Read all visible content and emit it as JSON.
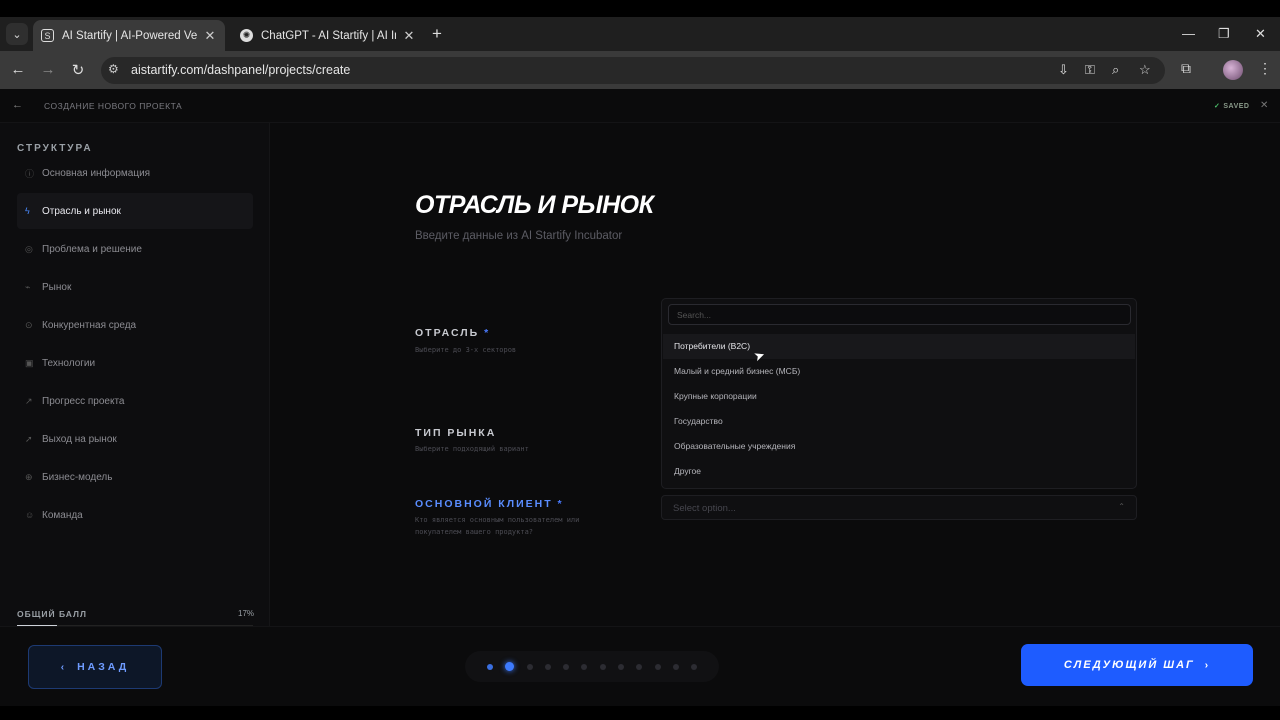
{
  "browser": {
    "tabs": [
      {
        "title": "AI Startify | AI-Powered Venture",
        "active": true
      },
      {
        "title": "ChatGPT - AI Startify | AI Incuba",
        "active": false
      }
    ],
    "url": "aistartify.com/dashpanel/projects/create"
  },
  "header": {
    "title": "СОЗДАНИЕ НОВОГО ПРОЕКТА",
    "saved": "SAVED"
  },
  "sidebar": {
    "title": "СТРУКТУРА",
    "items": [
      {
        "label": "Основная информация",
        "icon": "info-icon"
      },
      {
        "label": "Отрасль и рынок",
        "icon": "pulse-icon",
        "active": true
      },
      {
        "label": "Проблема и решение",
        "icon": "target-icon"
      },
      {
        "label": "Рынок",
        "icon": "chart-icon"
      },
      {
        "label": "Конкурентная среда",
        "icon": "compete-icon"
      },
      {
        "label": "Технологии",
        "icon": "chip-icon"
      },
      {
        "label": "Прогресс проекта",
        "icon": "progress-icon"
      },
      {
        "label": "Выход на рынок",
        "icon": "rocket-icon"
      },
      {
        "label": "Бизнес-модель",
        "icon": "globe-icon"
      },
      {
        "label": "Команда",
        "icon": "team-icon"
      }
    ],
    "score_label": "ОБЩИЙ БАЛЛ",
    "score_value": "17%",
    "score_fraction": 0.17
  },
  "main": {
    "title": "ОТРАСЛЬ И РЫНОК",
    "subtitle": "Введите данные из AI Startify Incubator",
    "fields": [
      {
        "label": "ОТРАСЛЬ",
        "required": "*",
        "hint": "Выберите до 3-х секторов"
      },
      {
        "label": "ТИП РЫНКА",
        "required": "",
        "hint": "Выберите подходящий вариант"
      },
      {
        "label": "ОСНОВНОЙ КЛИЕНТ",
        "required": "*",
        "hint": "Кто является основным пользователем или покупателем вашего продукта?"
      }
    ],
    "dropdown": {
      "search_placeholder": "Search...",
      "options": [
        "Потребители (B2C)",
        "Малый и средний бизнес (МСБ)",
        "Крупные корпорации",
        "Государство",
        "Образовательные учреждения",
        "Другое"
      ]
    },
    "select_placeholder": "Select option..."
  },
  "footer": {
    "back_label": "НАЗАД",
    "next_label": "СЛЕДУЮЩИЙ ШАГ",
    "steps_total": 12,
    "current_step": 2
  },
  "colors": {
    "accent": "#1e5cff",
    "background": "#0b0b0c"
  }
}
